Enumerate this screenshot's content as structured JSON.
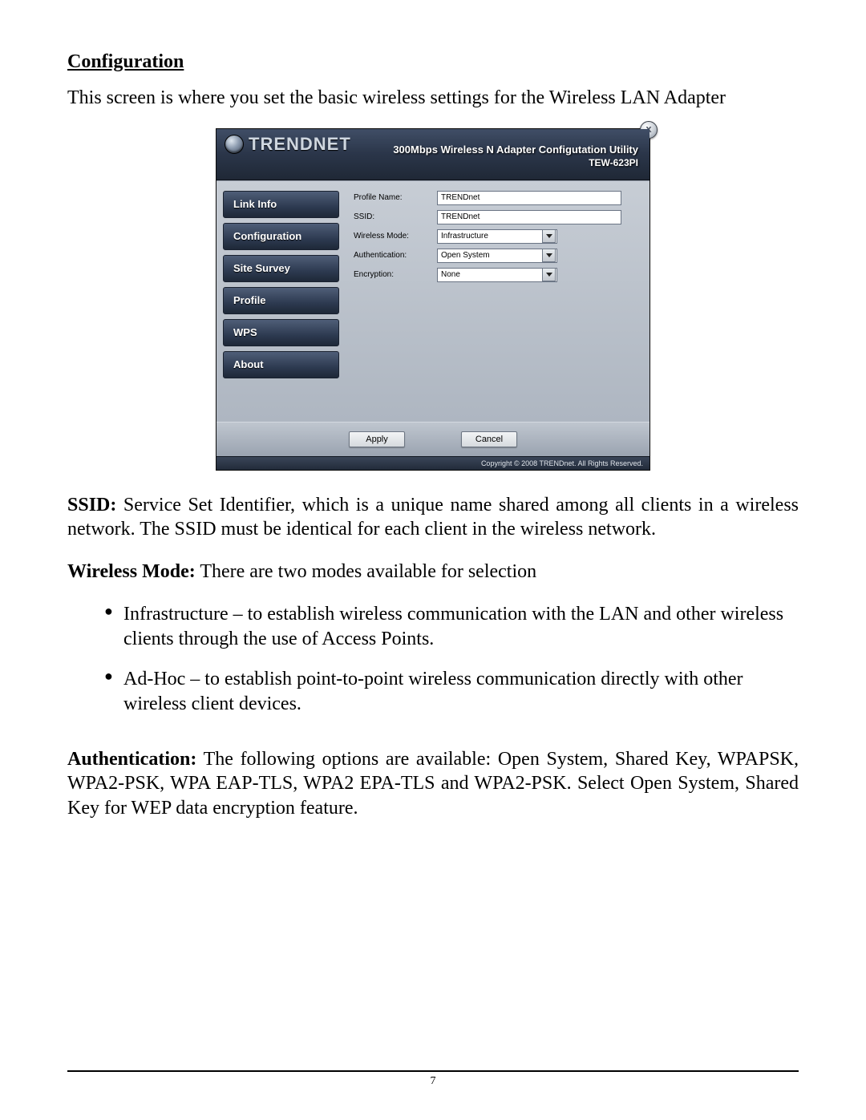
{
  "page_number": "7",
  "section_heading": "Configuration",
  "intro_text": "This screen is where you set the basic wireless settings for the Wireless LAN Adapter",
  "window": {
    "brand": "TRENDNET",
    "title": "300Mbps Wireless N Adapter Configutation Utility",
    "model": "TEW-623PI",
    "close_label": "x",
    "nav": [
      "Link Info",
      "Configuration",
      "Site Survey",
      "Profile",
      "WPS",
      "About"
    ],
    "form": {
      "profile_name_label": "Profile Name:",
      "profile_name_value": "TRENDnet",
      "ssid_label": "SSID:",
      "ssid_value": "TRENDnet",
      "wmode_label": "Wireless Mode:",
      "wmode_value": "Infrastructure",
      "auth_label": "Authentication:",
      "auth_value": "Open System",
      "enc_label": "Encryption:",
      "enc_value": "None"
    },
    "apply_label": "Apply",
    "cancel_label": "Cancel",
    "copyright": "Copyright © 2008 TRENDnet. All Rights Reserved."
  },
  "ssid_label": "SSID:",
  "ssid_para": " Service Set Identifier, which is a unique name shared among all clients in a wireless network. The SSID must be identical for each client in the wireless network.",
  "wmode_label": "Wireless Mode:",
  "wmode_para": " There are two modes available for selection",
  "bullet_infra": "Infrastructure – to establish wireless communication with the LAN and other wireless clients through the use of Access Points.",
  "bullet_adhoc": "Ad-Hoc – to establish point-to-point wireless communication directly with other wireless client devices.",
  "auth_label": "Authentication:",
  "auth_para": " The following options are available: Open System, Shared Key, WPAPSK, WPA2-PSK, WPA EAP-TLS, WPA2 EPA-TLS and WPA2-PSK. Select Open System, Shared Key for WEP data encryption feature."
}
